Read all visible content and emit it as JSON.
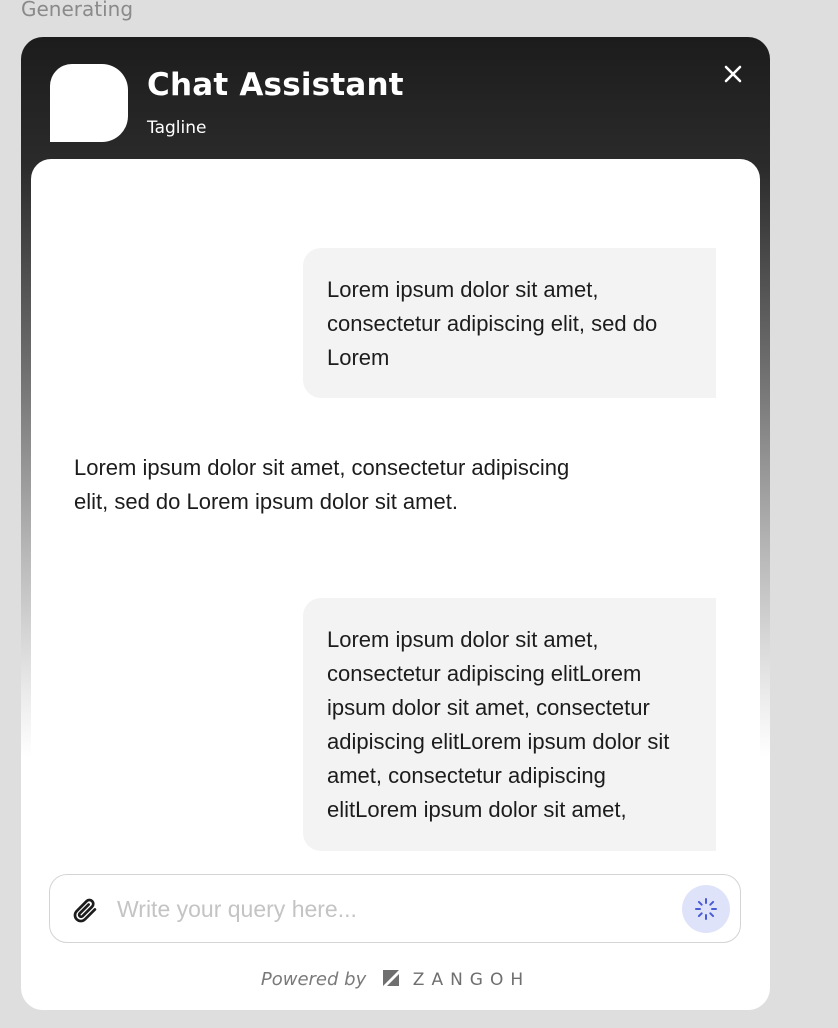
{
  "status": {
    "text": "Generating"
  },
  "header": {
    "title": "Chat Assistant",
    "tagline": "Tagline"
  },
  "messages": [
    {
      "role": "user",
      "text": "Lorem ipsum dolor sit amet, consectetur adipiscing elit, sed do Lorem"
    },
    {
      "role": "assistant",
      "text": "Lorem ipsum dolor sit amet, consectetur adipiscing elit, sed do Lorem ipsum dolor sit amet."
    },
    {
      "role": "user",
      "text": "Lorem ipsum dolor sit amet, consectetur adipiscing elitLorem ipsum dolor sit amet, consectetur adipiscing elitLorem ipsum dolor sit amet, consectetur adipiscing elitLorem ipsum dolor sit amet,"
    }
  ],
  "composer": {
    "placeholder": "Write your query here...",
    "value": ""
  },
  "footer": {
    "powered_by": "Powered by",
    "brand": "ZANGOH"
  },
  "icons": {
    "close": "close-icon",
    "attach": "paperclip-icon",
    "send": "spinner-icon",
    "brand": "zangoh-logo-icon"
  },
  "colors": {
    "header_dark": "#1c1c1c",
    "bubble_bg": "#f3f3f3",
    "send_bg": "#dfe3f9",
    "spinner": "#4a5bd6"
  }
}
